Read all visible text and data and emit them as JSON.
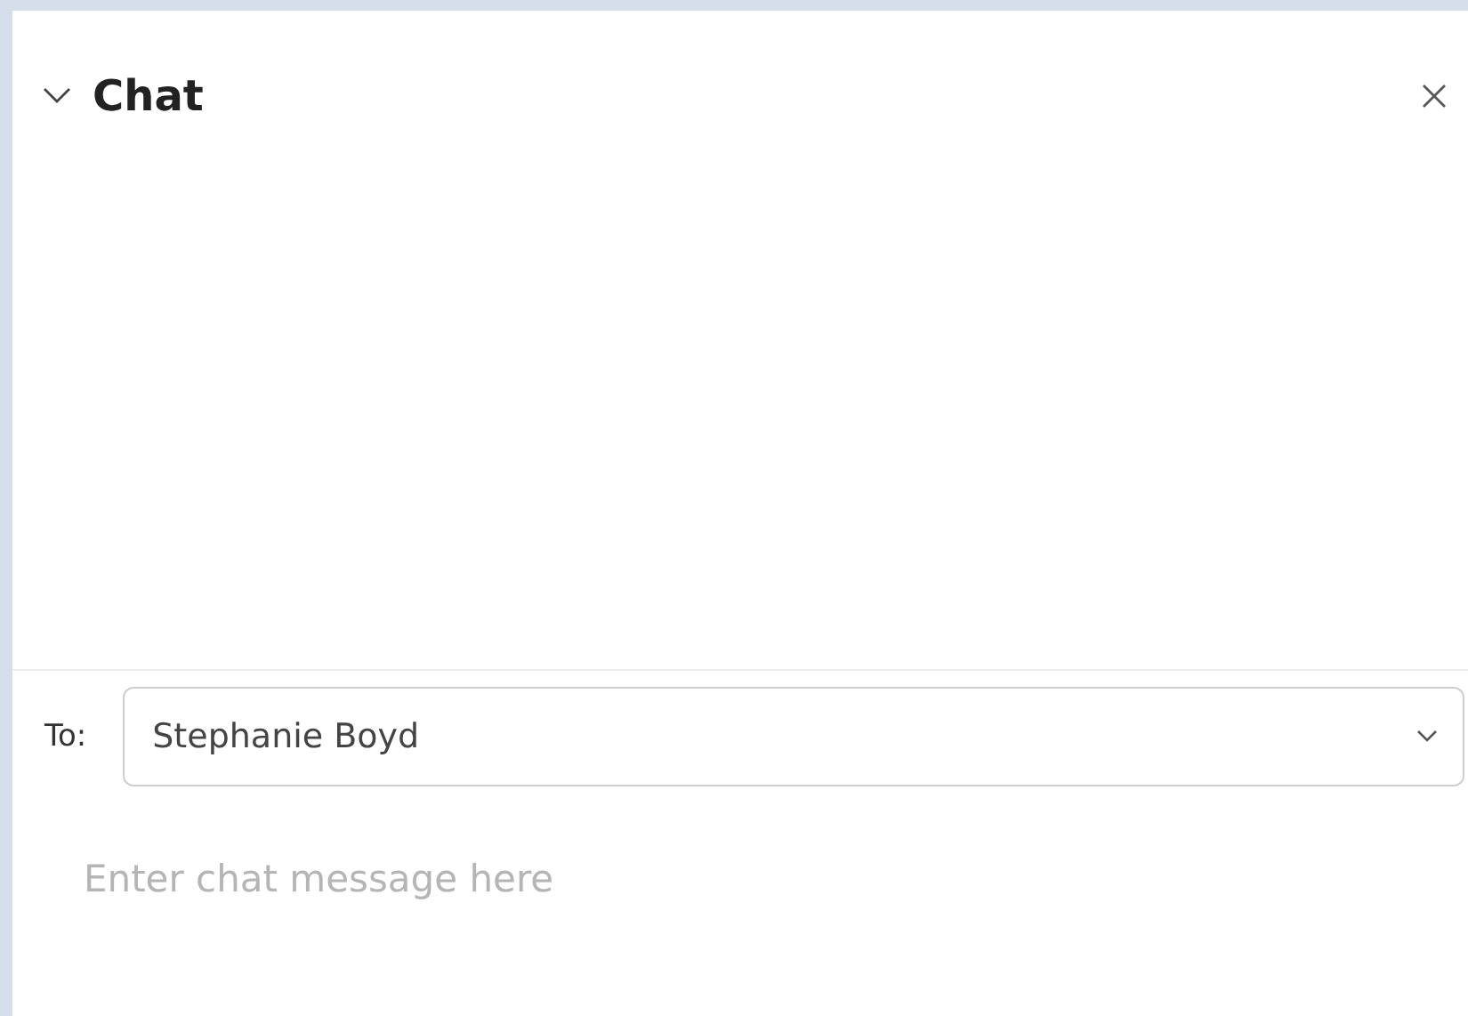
{
  "panel": {
    "title": "Chat",
    "expanded": true
  },
  "recipient": {
    "label": "To:",
    "value": "Stephanie Boyd"
  },
  "message": {
    "placeholder": "Enter chat message here"
  }
}
